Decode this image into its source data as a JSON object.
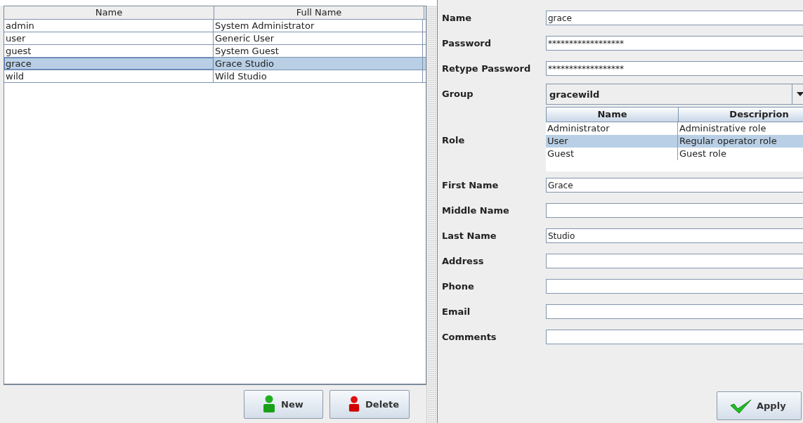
{
  "users_table": {
    "columns": [
      "Name",
      "Full Name"
    ],
    "rows": [
      {
        "name": "admin",
        "full_name": "System  Administrator",
        "selected": false
      },
      {
        "name": "user",
        "full_name": "Generic  User",
        "selected": false
      },
      {
        "name": "guest",
        "full_name": "System  Guest",
        "selected": false
      },
      {
        "name": "grace",
        "full_name": "Grace  Studio",
        "selected": true
      },
      {
        "name": "wild",
        "full_name": "Wild  Studio",
        "selected": false
      }
    ]
  },
  "buttons": [
    {
      "label": "New",
      "kind": "new"
    },
    {
      "label": "Delete",
      "kind": "delete"
    }
  ],
  "form": {
    "fields": [
      {
        "label": "Name",
        "kind": "text",
        "value": "grace"
      },
      {
        "label": "Password",
        "kind": "text",
        "value": "******************"
      },
      {
        "label": "Retype Password",
        "kind": "text",
        "value": "******************"
      },
      {
        "label": "Group",
        "kind": "combo",
        "value": "gracewild"
      },
      {
        "label": "Role",
        "kind": "table",
        "columns": [
          "Name",
          "Descriprion"
        ],
        "rows": [
          {
            "name": "Administrator",
            "description": "Administrative role",
            "selected": false
          },
          {
            "name": "User",
            "description": "Regular operator role",
            "selected": true
          },
          {
            "name": "Guest",
            "description": "Guest role",
            "selected": false
          }
        ]
      },
      {
        "label": "First Name",
        "kind": "text",
        "value": "Grace"
      },
      {
        "label": "Middle Name",
        "kind": "text"
      },
      {
        "label": "Last Name",
        "kind": "text",
        "value": "Studio"
      },
      {
        "label": "Address",
        "kind": "text"
      },
      {
        "label": "Phone",
        "kind": "text"
      },
      {
        "label": "Email",
        "kind": "text"
      },
      {
        "label": "Comments",
        "kind": "text"
      }
    ]
  },
  "apply_button": {
    "label": "Apply"
  }
}
